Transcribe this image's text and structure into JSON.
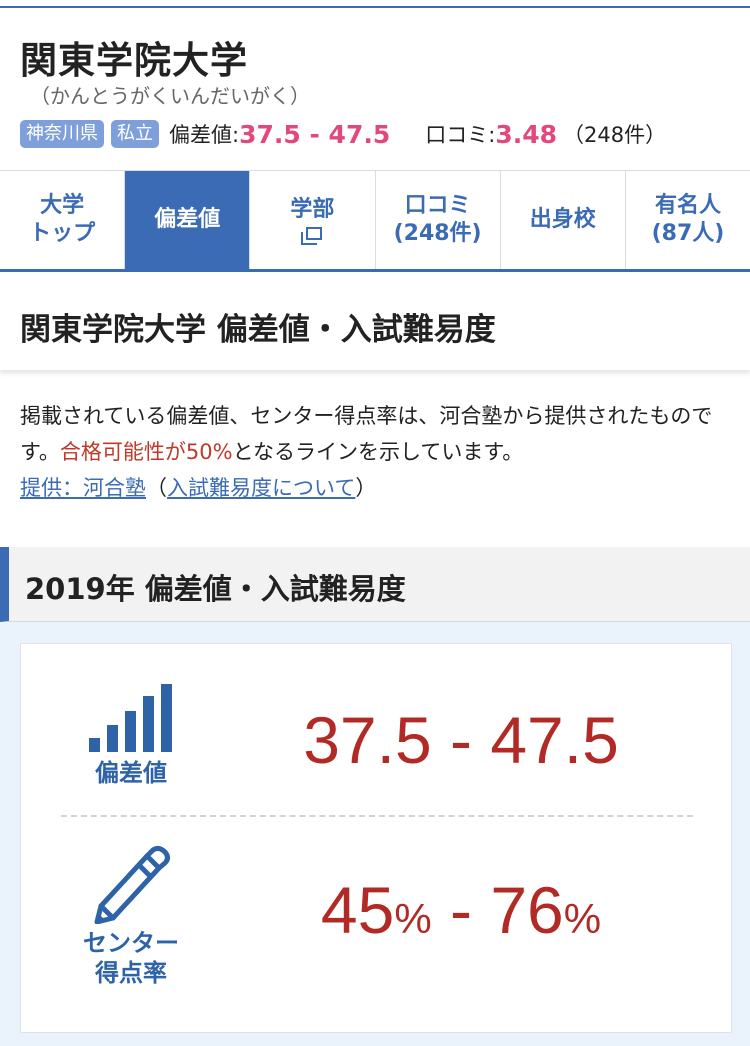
{
  "header": {
    "university_name": "関東学院大学",
    "university_kana": "（かんとうがくいんだいがく）",
    "prefecture_tag": "神奈川県",
    "type_tag": "私立",
    "hensachi_label": "偏差値:",
    "hensachi_value": "37.5 - 47.5",
    "review_label": "口コミ:",
    "review_value": "3.48",
    "review_count": "（248件）"
  },
  "tabs": [
    {
      "line1": "大学",
      "line2": "トップ"
    },
    {
      "line1": "偏差値",
      "line2": ""
    },
    {
      "line1": "学部",
      "line2": ""
    },
    {
      "line1": "口コミ",
      "line2": "(248件)"
    },
    {
      "line1": "出身校",
      "line2": ""
    },
    {
      "line1": "有名人",
      "line2": "(87人)"
    }
  ],
  "page_title": "関東学院大学 偏差値・入試難易度",
  "description": {
    "text1": "掲載されている偏差値、センター得点率は、河合塾から提供されたものです。",
    "highlight": "合格可能性が50%",
    "text2": "となるラインを示しています。",
    "provider_link": "提供：河合塾",
    "paren_open": "（",
    "about_link": "入試難易度について",
    "paren_close": "）"
  },
  "section_title": "2019年 偏差値・入試難易度",
  "stats": {
    "hensachi_label": "偏差値",
    "hensachi_range": "37.5 - 47.5",
    "center_label_1": "センター",
    "center_label_2": "得点率",
    "center_min": "45",
    "center_max": "76",
    "center_separator": " - ",
    "percent_sign": "%"
  },
  "colors": {
    "accent_blue": "#3b6bb5",
    "pink": "#e2487a",
    "value_red": "#b22a25",
    "tag_blue": "#7e9fd9"
  }
}
